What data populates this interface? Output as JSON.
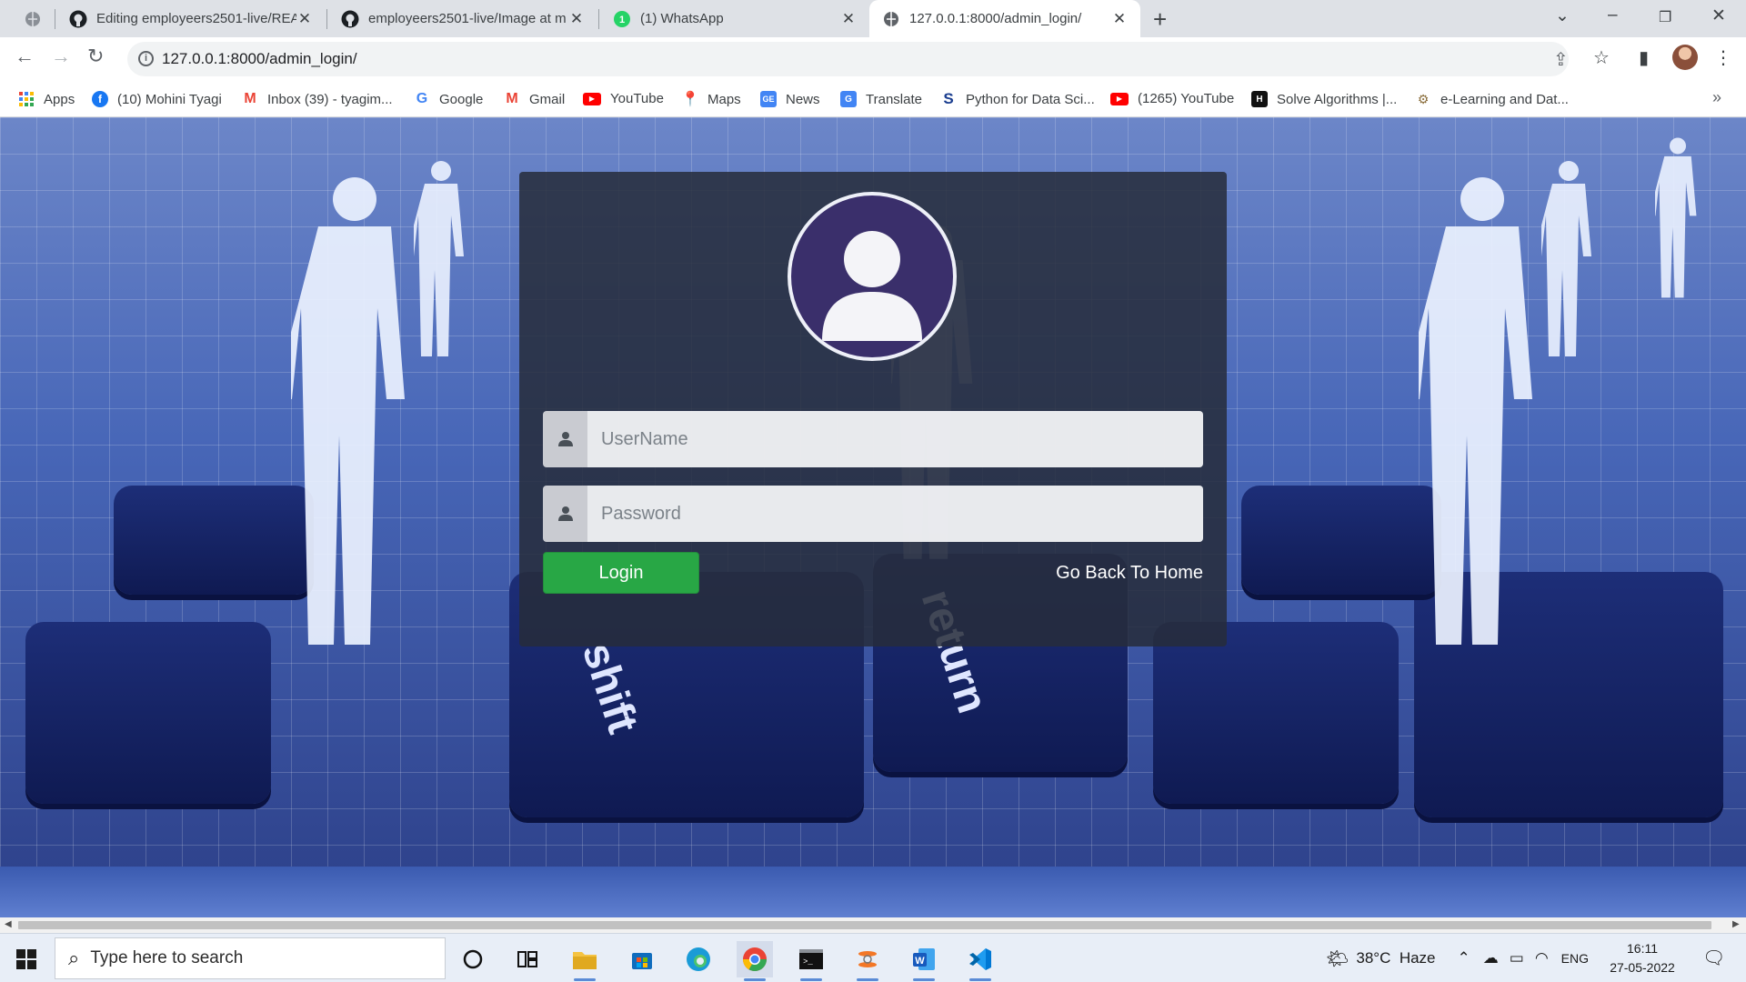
{
  "browser": {
    "tabs": [
      {
        "title": "Editing employeers2501-live/REA",
        "icon": "github-icon"
      },
      {
        "title": "employeers2501-live/Image at m",
        "icon": "github-icon"
      },
      {
        "title": "(1) WhatsApp",
        "icon": "whatsapp-icon"
      },
      {
        "title": "127.0.0.1:8000/admin_login/",
        "icon": "globe-icon",
        "active": true
      }
    ],
    "url": "127.0.0.1:8000/admin_login/",
    "bookmarks": [
      {
        "label": "Apps",
        "icon": "apps-grid-icon"
      },
      {
        "label": "(10) Mohini Tyagi",
        "icon": "facebook-icon"
      },
      {
        "label": "Inbox (39) - tyagim...",
        "icon": "gmail-icon"
      },
      {
        "label": "Google",
        "icon": "google-icon"
      },
      {
        "label": "Gmail",
        "icon": "gmail-icon"
      },
      {
        "label": "YouTube",
        "icon": "youtube-icon"
      },
      {
        "label": "Maps",
        "icon": "maps-icon"
      },
      {
        "label": "News",
        "icon": "news-icon"
      },
      {
        "label": "Translate",
        "icon": "translate-icon"
      },
      {
        "label": "Python for Data Sci...",
        "icon": "s-icon"
      },
      {
        "label": "(1265) YouTube",
        "icon": "youtube-icon"
      },
      {
        "label": "Solve Algorithms |...",
        "icon": "hackerrank-icon"
      },
      {
        "label": "e-Learning and Dat...",
        "icon": "elearning-icon"
      }
    ],
    "more_bookmarks": "»"
  },
  "login": {
    "username_placeholder": "UserName",
    "password_placeholder": "Password",
    "login_label": "Login",
    "home_link": "Go Back To Home"
  },
  "page_background": {
    "key_shift": "shift",
    "key_return": "return"
  },
  "taskbar": {
    "search_placeholder": "Type here to search",
    "weather": "38°C  Haze",
    "language": "ENG",
    "time": "16:11",
    "date": "27-05-2022"
  },
  "colors": {
    "login_green": "#28a745",
    "card_bg": "#262c3a",
    "avatar_purple": "#3a2f6b"
  }
}
